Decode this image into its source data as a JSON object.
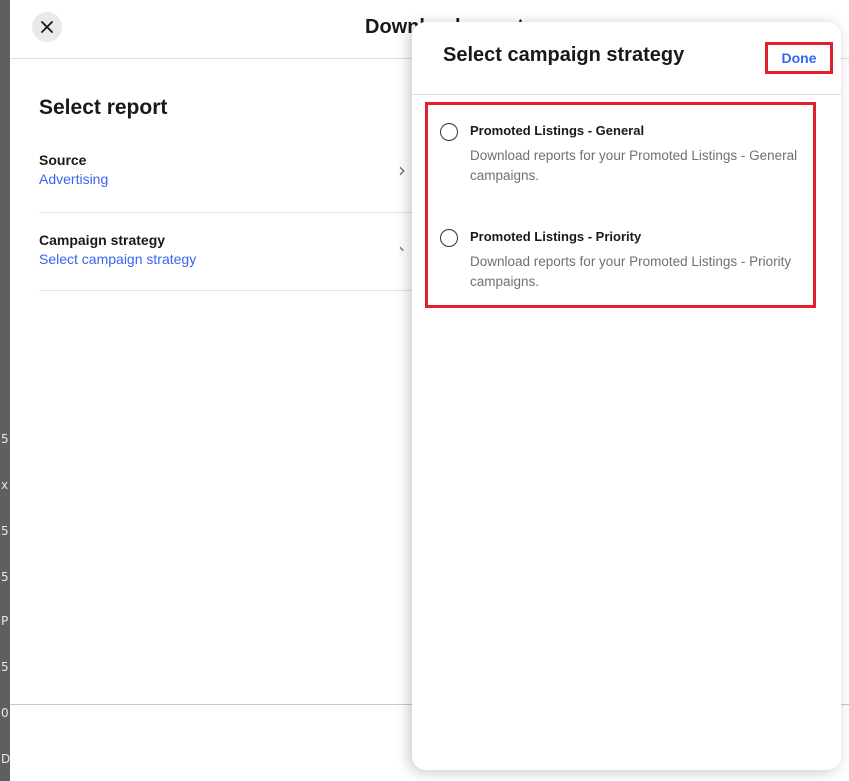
{
  "modal": {
    "title": "Download reports",
    "close_icon": "close-icon",
    "left_panel": {
      "heading": "Select report",
      "rows": [
        {
          "label": "Source",
          "value": "Advertising",
          "icon": "chevron-right-icon"
        },
        {
          "label": "Campaign strategy",
          "value": "Select campaign strategy",
          "icon": "chevron-right-icon"
        }
      ]
    }
  },
  "sheet": {
    "title": "Select campaign strategy",
    "done_label": "Done",
    "options": [
      {
        "title": "Promoted Listings - General",
        "description": "Download reports for your Promoted Listings - General campaigns.",
        "selected": false
      },
      {
        "title": "Promoted Listings - Priority",
        "description": "Download reports for your Promoted Listings - Priority campaigns.",
        "selected": false
      }
    ]
  },
  "background_edge_chars": [
    "5",
    "x",
    "5",
    "5",
    "P",
    "5",
    "0",
    "D"
  ],
  "colors": {
    "accent": "#3665f3",
    "highlight": "#e0202e",
    "text": "#191919",
    "muted": "#707070"
  }
}
